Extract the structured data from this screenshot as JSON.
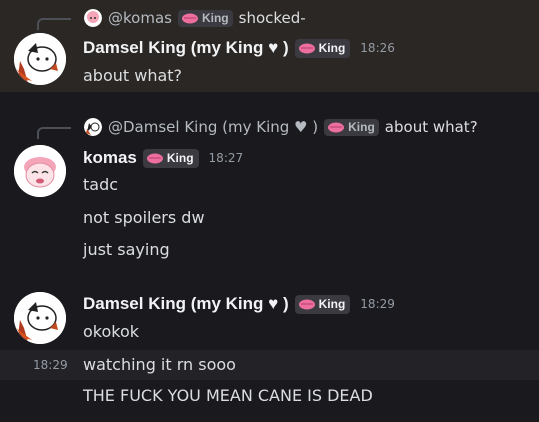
{
  "messages": [
    {
      "reply": {
        "name": "@komas",
        "tag": "King",
        "text": "shocked-"
      },
      "author": "Damsel King (my King ♥ )",
      "tag": "King",
      "time": "18:26",
      "lines": [
        "about what?"
      ]
    },
    {
      "reply": {
        "name": "@Damsel King (my King ♥ )",
        "tag": "King",
        "text": "about what?"
      },
      "author": "komas",
      "tag": "King",
      "time": "18:27",
      "lines": [
        "tadc",
        "not spoilers dw",
        "just saying"
      ]
    },
    {
      "author": "Damsel King (my King ♥ )",
      "tag": "King",
      "time": "18:29",
      "lines": [
        "okokok",
        "watching it rn sooo",
        "THE FUCK YOU MEAN CANE IS DEAD"
      ],
      "hover_time": "18:29"
    }
  ],
  "colors": {
    "background": "#1a1a1e",
    "highlight": "#2b2724",
    "tag_pink": "#ec6f9e"
  },
  "icons": [
    "king-tag-icon",
    "avatar-image"
  ]
}
